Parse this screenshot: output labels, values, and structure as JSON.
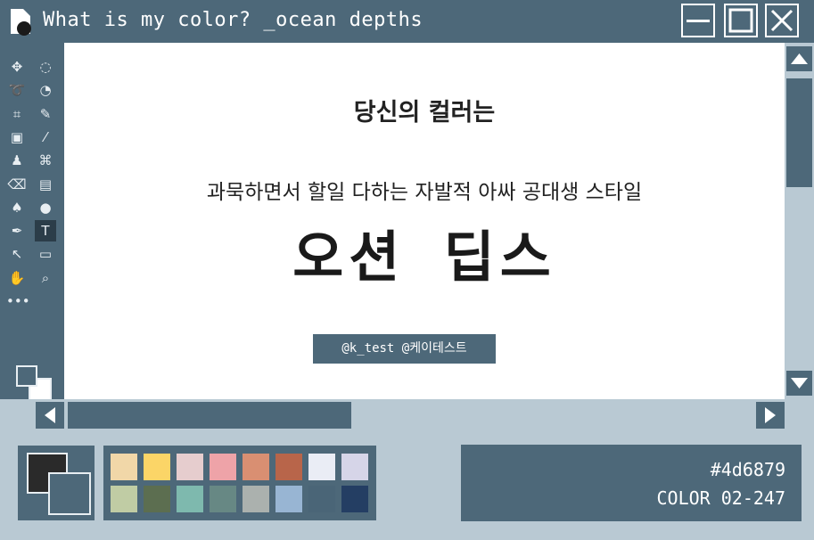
{
  "window": {
    "title": "What is my color? _ocean depths",
    "icons": {
      "app": "document-icon",
      "minimize": "minimize-icon",
      "maximize": "maximize-icon",
      "close": "close-icon"
    }
  },
  "tools": [
    {
      "name": "move-tool-icon",
      "glyph": "✥"
    },
    {
      "name": "ellipse-select-icon",
      "glyph": "◌"
    },
    {
      "name": "lasso-icon",
      "glyph": "➰"
    },
    {
      "name": "magic-select-icon",
      "glyph": "◔"
    },
    {
      "name": "crop-icon",
      "glyph": "⌗"
    },
    {
      "name": "eyedropper-icon",
      "glyph": "✎"
    },
    {
      "name": "patch-icon",
      "glyph": "▣"
    },
    {
      "name": "brush-icon",
      "glyph": "⁄"
    },
    {
      "name": "stamp-icon",
      "glyph": "♟"
    },
    {
      "name": "history-brush-icon",
      "glyph": "⌘"
    },
    {
      "name": "eraser-icon",
      "glyph": "⌫"
    },
    {
      "name": "gradient-icon",
      "glyph": "▤"
    },
    {
      "name": "blur-icon",
      "glyph": "♠"
    },
    {
      "name": "dodge-icon",
      "glyph": "●"
    },
    {
      "name": "pen-icon",
      "glyph": "✒"
    },
    {
      "name": "type-tool-icon",
      "glyph": "T"
    },
    {
      "name": "path-select-icon",
      "glyph": "↖"
    },
    {
      "name": "rectangle-icon",
      "glyph": "▭"
    },
    {
      "name": "hand-icon",
      "glyph": "✋"
    },
    {
      "name": "zoom-icon",
      "glyph": "⌕"
    },
    {
      "name": "more-tools-icon",
      "glyph": "•••"
    }
  ],
  "canvas": {
    "heading": "당신의 컬러는",
    "description": "과묵하면서 할일 다하는 자발적 아싸 공대생 스타일",
    "color_name": "오션 딥스",
    "credit": "@k_test @케이테스트"
  },
  "palette": {
    "current_fg": "#2a2a2a",
    "current_bg": "#4d6879",
    "swatches": [
      "#f1d7a8",
      "#fbd567",
      "#e6cdce",
      "#eea3a8",
      "#d98f72",
      "#b8654a",
      "#eaedf5",
      "#d6d5e8",
      "#c0cca4",
      "#5c6e50",
      "#7eb9ae",
      "#678884",
      "#abb1ae",
      "#98b5d3",
      "#4a6577",
      "#243e63"
    ]
  },
  "info": {
    "hex": "#4d6879",
    "code": "COLOR 02-247"
  },
  "colors": {
    "primary": "#4d6879",
    "background": "#b9c9d3",
    "canvas": "#ffffff"
  }
}
